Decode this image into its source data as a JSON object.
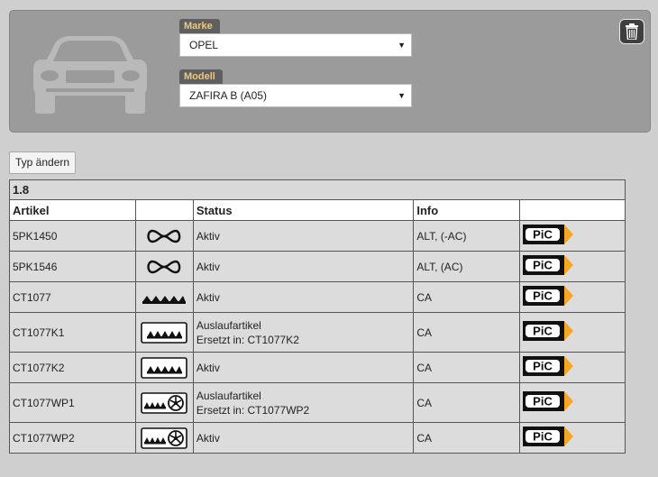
{
  "vehicle": {
    "brand_label": "Marke",
    "brand_value": "OPEL",
    "model_label": "Modell",
    "model_value": "ZAFIRA B (A05)"
  },
  "actions": {
    "change_type_label": "Typ ändern",
    "delete_icon": "trash-icon"
  },
  "table": {
    "engine_type": "1.8",
    "columns": [
      "Artikel",
      "",
      "Status",
      "Info",
      ""
    ],
    "rows": [
      {
        "article": "5PK1450",
        "icon": "belt-icon",
        "status": "Aktiv",
        "status_replacement": "",
        "info": "ALT, (-AC)",
        "logo": "pic-logo"
      },
      {
        "article": "5PK1546",
        "icon": "belt-icon",
        "status": "Aktiv",
        "status_replacement": "",
        "info": "ALT, (AC)",
        "logo": "pic-logo"
      },
      {
        "article": "CT1077",
        "icon": "timing-belt-icon",
        "status": "Aktiv",
        "status_replacement": "",
        "info": "CA",
        "logo": "pic-logo"
      },
      {
        "article": "CT1077K1",
        "icon": "timing-belt-kit-icon",
        "status": "Auslaufartikel",
        "status_replacement": "Ersetzt in: CT1077K2",
        "info": "CA",
        "logo": "pic-logo"
      },
      {
        "article": "CT1077K2",
        "icon": "timing-belt-kit-icon",
        "status": "Aktiv",
        "status_replacement": "",
        "info": "CA",
        "logo": "pic-logo"
      },
      {
        "article": "CT1077WP1",
        "icon": "timing-belt-kit-water-pump-icon",
        "status": "Auslaufartikel",
        "status_replacement": "Ersetzt in: CT1077WP2",
        "info": "CA",
        "logo": "pic-logo"
      },
      {
        "article": "CT1077WP2",
        "icon": "timing-belt-kit-water-pump-icon",
        "status": "Aktiv",
        "status_replacement": "",
        "info": "CA",
        "logo": "pic-logo"
      }
    ]
  },
  "colors": {
    "panel_bg": "#9b9b9b",
    "label_bg": "#5f5f5f",
    "label_text": "#f0c878",
    "logo_orange": "#f5a623"
  }
}
